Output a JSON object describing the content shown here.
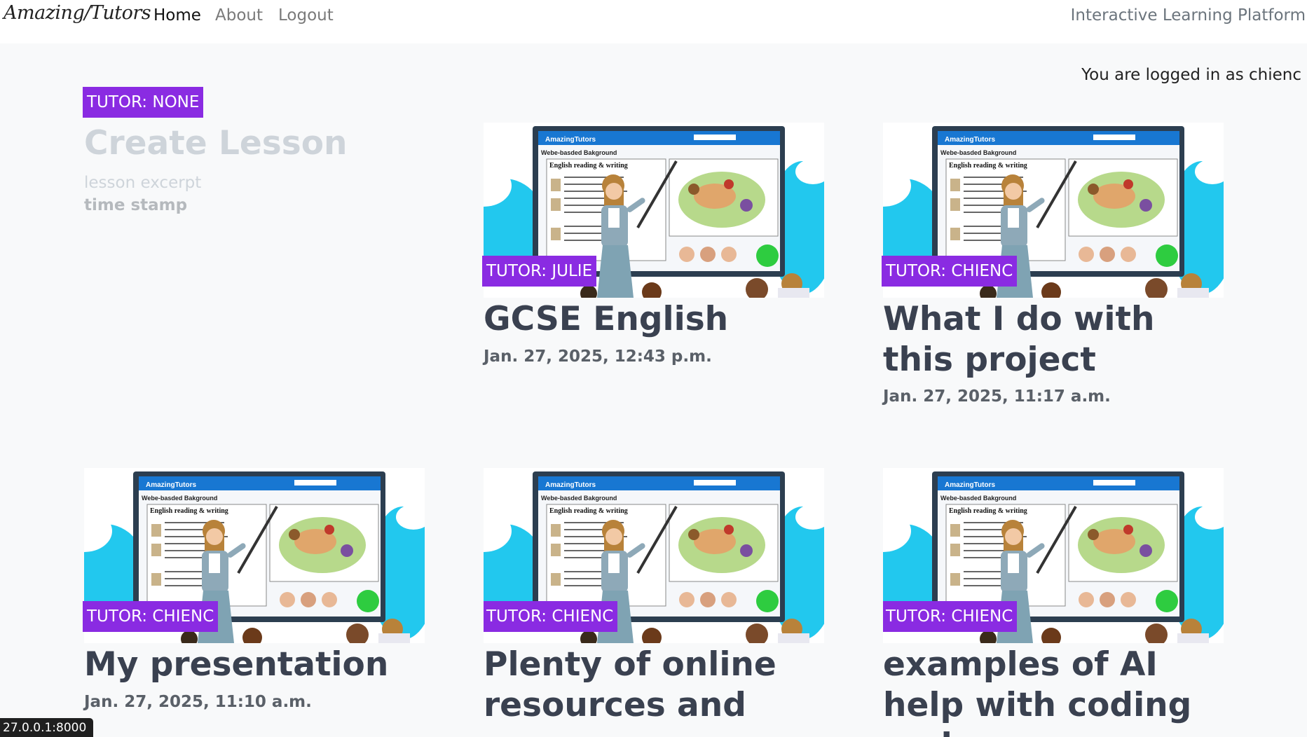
{
  "nav": {
    "brand": "Amazing/Tutors",
    "links": [
      {
        "label": "Home"
      },
      {
        "label": "About"
      },
      {
        "label": "Logout"
      }
    ],
    "tagline": "Interactive Learning Platform"
  },
  "user": {
    "logged_in_text": "You are logged in as chienc"
  },
  "create_card": {
    "badge": "TUTOR: NONE",
    "title": "Create Lesson",
    "excerpt": "lesson excerpt",
    "timestamp": "time stamp"
  },
  "lessons": [
    {
      "badge": "TUTOR: JULIE",
      "title": "GCSE English",
      "date": "Jan. 27, 2025, 12:43 p.m."
    },
    {
      "badge": "TUTOR: CHIENC",
      "title": "What I do with this project",
      "date": "Jan. 27, 2025, 11:17 a.m."
    },
    {
      "badge": "TUTOR: CHIENC",
      "title": "My presentation",
      "date": "Jan. 27, 2025, 11:10 a.m."
    },
    {
      "badge": "TUTOR: CHIENC",
      "title": "Plenty of online resources and",
      "date": ""
    },
    {
      "badge": "TUTOR: CHIENC",
      "title": "examples of AI help with coding and",
      "date": ""
    }
  ],
  "thumbnail_text": {
    "site": "AmazingTutors",
    "heading": "Webe-basded Bakground",
    "lesson": "English  reading & writing"
  },
  "status_url": "27.0.0.1:8000",
  "colors": {
    "badge": "#8a2be2",
    "sky": "#22c8ee",
    "screen_frame": "#2c3e50"
  }
}
